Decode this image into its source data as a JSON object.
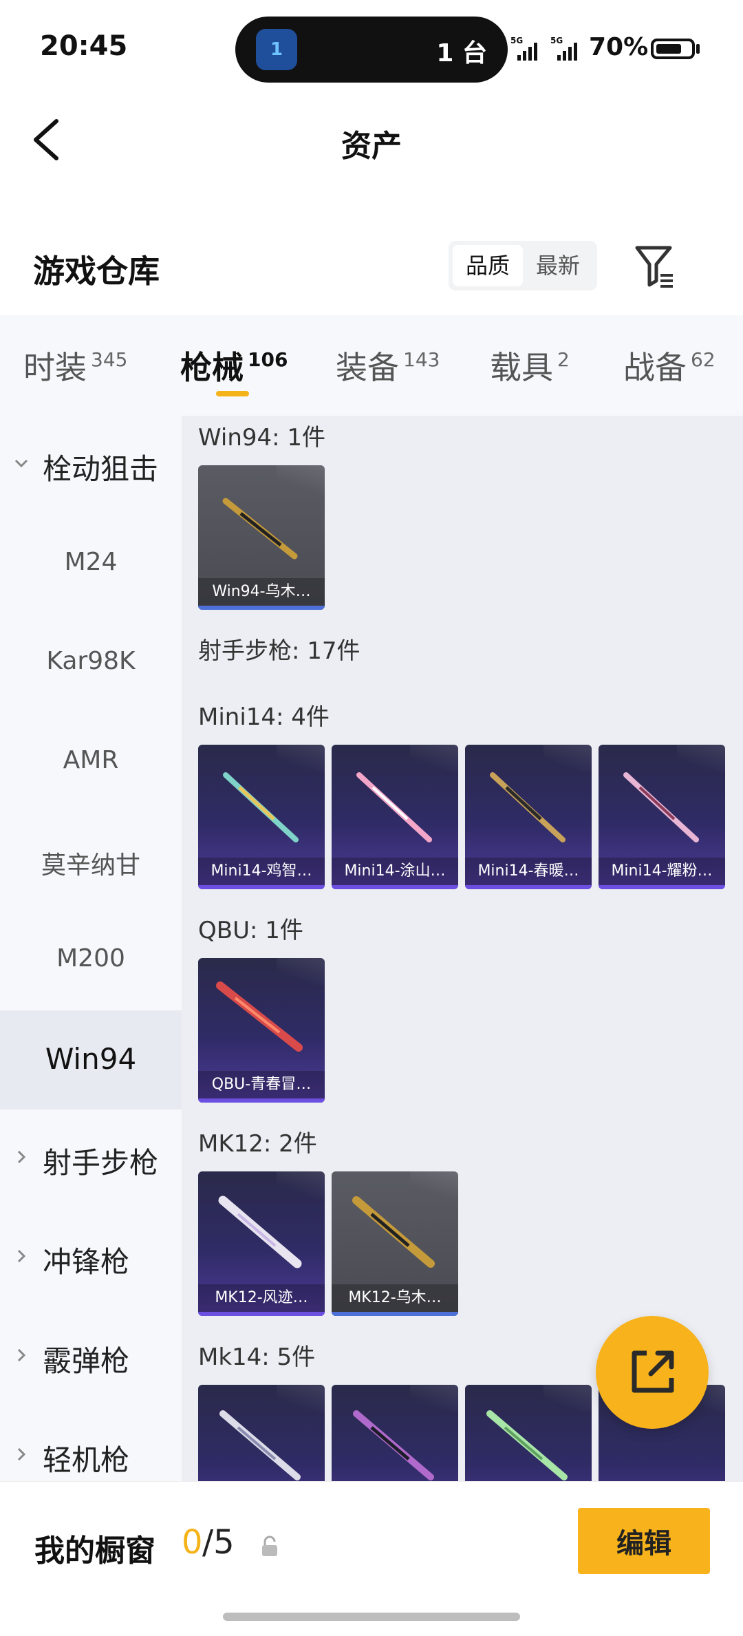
{
  "status_bar": {
    "time": "20:45",
    "island_text": "1 台",
    "island_badge": "1",
    "net1": "5G",
    "net2": "5G",
    "battery": "70%"
  },
  "header": {
    "title": "资产"
  },
  "warehouse": {
    "title": "游戏仓库",
    "sort": [
      "品质",
      "最新"
    ]
  },
  "tabs": [
    {
      "label": "时装",
      "count": "345"
    },
    {
      "label": "枪械",
      "count": "106"
    },
    {
      "label": "装备",
      "count": "143"
    },
    {
      "label": "载具",
      "count": "2"
    },
    {
      "label": "战备",
      "count": "62"
    }
  ],
  "sidebar": {
    "group_open": "栓动狙击",
    "subs": [
      "M24",
      "Kar98K",
      "AMR",
      "莫辛纳甘",
      "M200"
    ],
    "selected": "Win94",
    "groups": [
      "射手步枪",
      "冲锋枪",
      "霰弹枪",
      "轻机枪"
    ]
  },
  "content": {
    "sections": [
      {
        "title": "Win94: 1件",
        "items": [
          "Win94-乌木…"
        ]
      },
      {
        "title": "射手步枪: 17件"
      },
      {
        "title": "Mini14: 4件",
        "items": [
          "Mini14-鸡智…",
          "Mini14-涂山…",
          "Mini14-春暖…",
          "Mini14-耀粉…"
        ]
      },
      {
        "title": "QBU: 1件",
        "items": [
          "QBU-青春冒…"
        ]
      },
      {
        "title": "MK12: 2件",
        "items": [
          "MK12-风迹…",
          "MK12-乌木…"
        ]
      },
      {
        "title": "Mk14: 5件"
      }
    ]
  },
  "bottom": {
    "title": "我的橱窗",
    "used": "0",
    "total": "/5",
    "edit": "编辑"
  },
  "colors": {
    "accent": "#f7b21c",
    "rare_bg": "#2f2b66",
    "common_bg": "#4f5058"
  }
}
